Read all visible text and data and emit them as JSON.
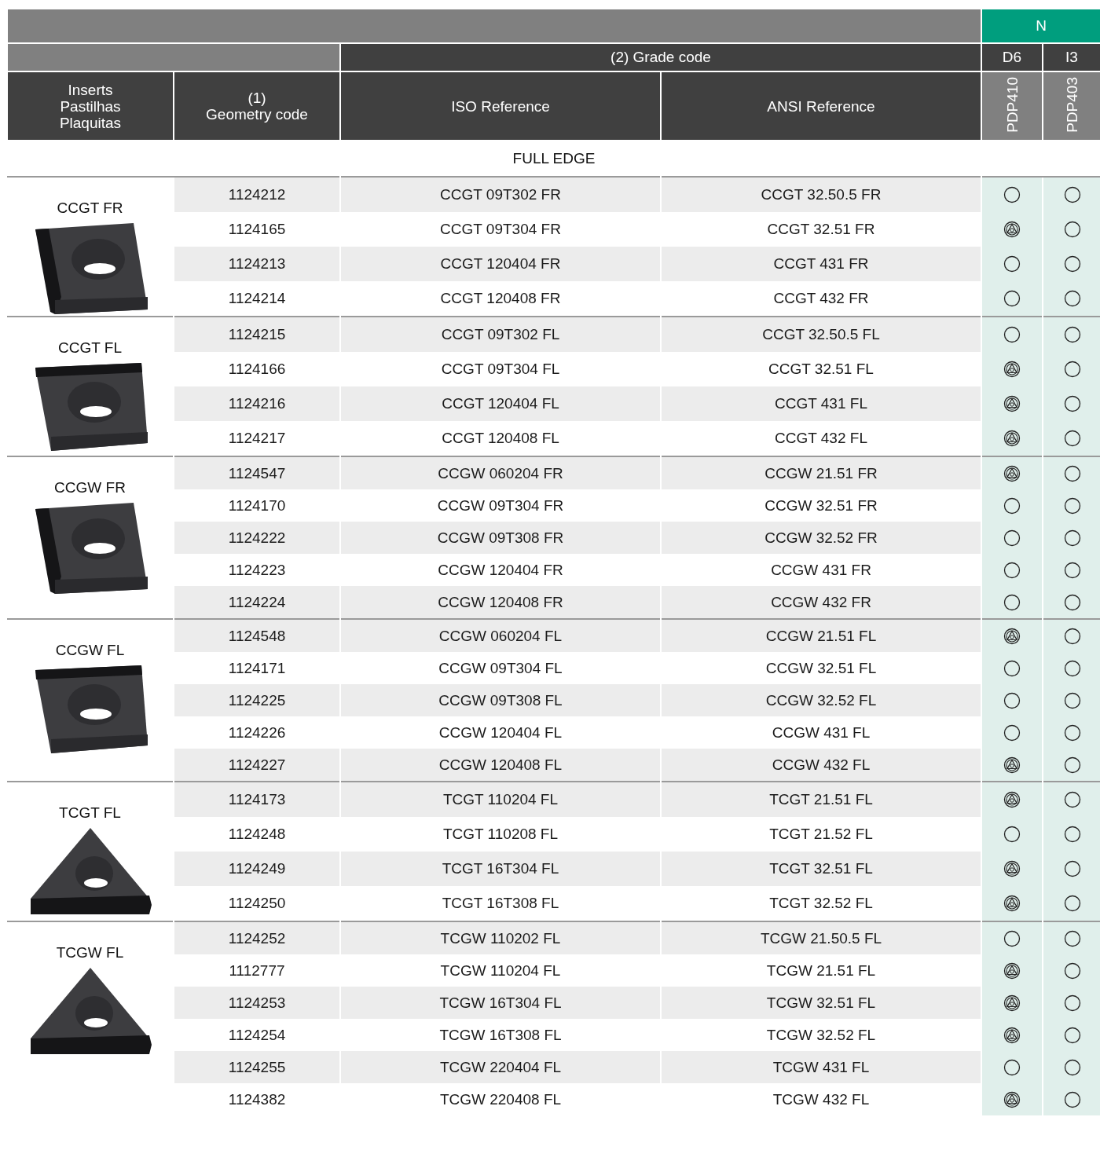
{
  "header": {
    "material_group": "N",
    "grade_code_label": "(2) Grade code",
    "grade_groups": [
      "D6",
      "I3"
    ],
    "inserts_label": [
      "Inserts",
      "Pastilhas",
      "Plaquitas"
    ],
    "geometry_number": "(1)",
    "geometry_label": "Geometry code",
    "iso_label": "ISO Reference",
    "ansi_label": "ANSI Reference",
    "grades": [
      "PDP410",
      "PDP403"
    ]
  },
  "section_title": "FULL EDGE",
  "groups": [
    {
      "name": "CCGT FR",
      "kind": "side",
      "rows": [
        {
          "code": "1124212",
          "iso": "CCGT 09T302 FR",
          "ansi": "CCGT 32.50.5 FR",
          "grades": [
            {
              "kind": "circle"
            },
            {
              "kind": "circle"
            }
          ]
        },
        {
          "code": "1124165",
          "iso": "CCGT 09T304 FR",
          "ansi": "CCGT 32.51 FR",
          "grades": [
            {
              "kind": "symbol"
            },
            {
              "kind": "circle"
            }
          ]
        },
        {
          "code": "1124213",
          "iso": "CCGT 120404 FR",
          "ansi": "CCGT 431 FR",
          "grades": [
            {
              "kind": "circle"
            },
            {
              "kind": "circle"
            }
          ]
        },
        {
          "code": "1124214",
          "iso": "CCGT 120408 FR",
          "ansi": "CCGT 432 FR",
          "grades": [
            {
              "kind": "circle"
            },
            {
              "kind": "circle"
            }
          ]
        }
      ]
    },
    {
      "name": "CCGT FL",
      "kind": "top",
      "rows": [
        {
          "code": "1124215",
          "iso": "CCGT 09T302 FL",
          "ansi": "CCGT 32.50.5 FL",
          "grades": [
            {
              "kind": "circle"
            },
            {
              "kind": "circle"
            }
          ]
        },
        {
          "code": "1124166",
          "iso": "CCGT 09T304 FL",
          "ansi": "CCGT 32.51 FL",
          "grades": [
            {
              "kind": "symbol"
            },
            {
              "kind": "circle"
            }
          ]
        },
        {
          "code": "1124216",
          "iso": "CCGT 120404 FL",
          "ansi": "CCGT 431 FL",
          "grades": [
            {
              "kind": "symbol"
            },
            {
              "kind": "circle"
            }
          ]
        },
        {
          "code": "1124217",
          "iso": "CCGT 120408 FL",
          "ansi": "CCGT 432 FL",
          "grades": [
            {
              "kind": "symbol"
            },
            {
              "kind": "circle"
            }
          ]
        }
      ]
    },
    {
      "name": "CCGW FR",
      "kind": "side",
      "rows": [
        {
          "code": "1124547",
          "iso": "CCGW 060204 FR",
          "ansi": "CCGW 21.51 FR",
          "grades": [
            {
              "kind": "symbol"
            },
            {
              "kind": "circle"
            }
          ]
        },
        {
          "code": "1124170",
          "iso": "CCGW 09T304 FR",
          "ansi": "CCGW 32.51 FR",
          "grades": [
            {
              "kind": "circle"
            },
            {
              "kind": "circle"
            }
          ]
        },
        {
          "code": "1124222",
          "iso": "CCGW 09T308 FR",
          "ansi": "CCGW 32.52 FR",
          "grades": [
            {
              "kind": "circle"
            },
            {
              "kind": "circle"
            }
          ]
        },
        {
          "code": "1124223",
          "iso": "CCGW 120404 FR",
          "ansi": "CCGW 431 FR",
          "grades": [
            {
              "kind": "circle"
            },
            {
              "kind": "circle"
            }
          ]
        },
        {
          "code": "1124224",
          "iso": "CCGW 120408 FR",
          "ansi": "CCGW 432 FR",
          "grades": [
            {
              "kind": "circle"
            },
            {
              "kind": "circle"
            }
          ]
        }
      ]
    },
    {
      "name": "CCGW FL",
      "kind": "top",
      "rows": [
        {
          "code": "1124548",
          "iso": "CCGW 060204 FL",
          "ansi": "CCGW 21.51 FL",
          "grades": [
            {
              "kind": "symbol"
            },
            {
              "kind": "circle"
            }
          ]
        },
        {
          "code": "1124171",
          "iso": "CCGW 09T304 FL",
          "ansi": "CCGW 32.51 FL",
          "grades": [
            {
              "kind": "circle"
            },
            {
              "kind": "circle"
            }
          ]
        },
        {
          "code": "1124225",
          "iso": "CCGW 09T308 FL",
          "ansi": "CCGW 32.52 FL",
          "grades": [
            {
              "kind": "circle"
            },
            {
              "kind": "circle"
            }
          ]
        },
        {
          "code": "1124226",
          "iso": "CCGW 120404 FL",
          "ansi": "CCGW 431 FL",
          "grades": [
            {
              "kind": "circle"
            },
            {
              "kind": "circle"
            }
          ]
        },
        {
          "code": "1124227",
          "iso": "CCGW 120408 FL",
          "ansi": "CCGW 432 FL",
          "grades": [
            {
              "kind": "symbol"
            },
            {
              "kind": "circle"
            }
          ]
        }
      ]
    },
    {
      "name": "TCGT FL",
      "kind": "triangle",
      "rows": [
        {
          "code": "1124173",
          "iso": "TCGT 110204 FL",
          "ansi": "TCGT 21.51 FL",
          "grades": [
            {
              "kind": "symbol"
            },
            {
              "kind": "circle"
            }
          ]
        },
        {
          "code": "1124248",
          "iso": "TCGT 110208 FL",
          "ansi": "TCGT 21.52 FL",
          "grades": [
            {
              "kind": "circle"
            },
            {
              "kind": "circle"
            }
          ]
        },
        {
          "code": "1124249",
          "iso": "TCGT 16T304 FL",
          "ansi": "TCGT 32.51 FL",
          "grades": [
            {
              "kind": "symbol"
            },
            {
              "kind": "circle"
            }
          ]
        },
        {
          "code": "1124250",
          "iso": "TCGT 16T308 FL",
          "ansi": "TCGT 32.52 FL",
          "grades": [
            {
              "kind": "symbol"
            },
            {
              "kind": "circle"
            }
          ]
        }
      ]
    },
    {
      "name": "TCGW FL",
      "kind": "triangle",
      "rows": [
        {
          "code": "1124252",
          "iso": "TCGW 110202 FL",
          "ansi": "TCGW 21.50.5 FL",
          "grades": [
            {
              "kind": "circle"
            },
            {
              "kind": "circle"
            }
          ]
        },
        {
          "code": "1112777",
          "iso": "TCGW 110204 FL",
          "ansi": "TCGW 21.51 FL",
          "grades": [
            {
              "kind": "symbol"
            },
            {
              "kind": "circle"
            }
          ]
        },
        {
          "code": "1124253",
          "iso": "TCGW 16T304 FL",
          "ansi": "TCGW 32.51 FL",
          "grades": [
            {
              "kind": "symbol"
            },
            {
              "kind": "circle"
            }
          ]
        },
        {
          "code": "1124254",
          "iso": "TCGW 16T308 FL",
          "ansi": "TCGW 32.52 FL",
          "grades": [
            {
              "kind": "symbol"
            },
            {
              "kind": "circle"
            }
          ]
        },
        {
          "code": "1124255",
          "iso": "TCGW 220404 FL",
          "ansi": "TCGW 431 FL",
          "grades": [
            {
              "kind": "circle"
            },
            {
              "kind": "circle"
            }
          ]
        },
        {
          "code": "1124382",
          "iso": "TCGW 220408 FL",
          "ansi": "TCGW 432 FL",
          "grades": [
            {
              "kind": "symbol"
            },
            {
              "kind": "circle"
            }
          ]
        }
      ]
    }
  ]
}
